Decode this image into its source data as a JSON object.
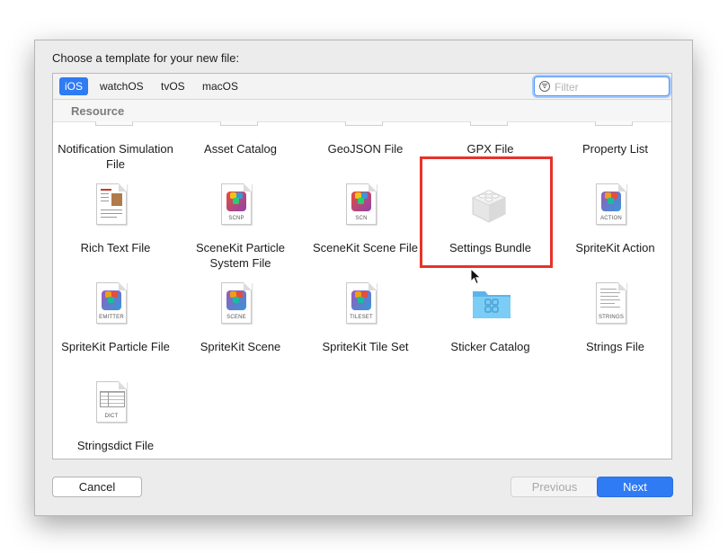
{
  "dialog": {
    "prompt": "Choose a template for your new file:"
  },
  "platform_tabs": [
    {
      "label": "iOS",
      "selected": true
    },
    {
      "label": "watchOS",
      "selected": false
    },
    {
      "label": "tvOS",
      "selected": false
    },
    {
      "label": "macOS",
      "selected": false
    }
  ],
  "filter": {
    "placeholder": "Filter",
    "value": "",
    "icon": "filter-icon"
  },
  "section": {
    "title": "Resource"
  },
  "templates": [
    {
      "label": "Notification Simulation File",
      "icon": "document-icon",
      "selected": false
    },
    {
      "label": "Asset Catalog",
      "icon": "asset-catalog-icon",
      "selected": false
    },
    {
      "label": "GeoJSON File",
      "icon": "geojson-icon",
      "selected": false
    },
    {
      "label": "GPX File",
      "icon": "gpx-icon",
      "selected": false
    },
    {
      "label": "Property List",
      "icon": "property-list-icon",
      "selected": false
    },
    {
      "label": "Rich Text File",
      "icon": "rich-text-icon",
      "selected": false
    },
    {
      "label": "SceneKit Particle System File",
      "icon": "scenekit-icon",
      "tag": "SCNP",
      "selected": false
    },
    {
      "label": "SceneKit Scene File",
      "icon": "scenekit-icon",
      "tag": "SCN",
      "selected": false
    },
    {
      "label": "Settings Bundle",
      "icon": "lego-brick-icon",
      "selected": true
    },
    {
      "label": "SpriteKit Action",
      "icon": "spritekit-icon",
      "tag": "ACTION",
      "selected": false
    },
    {
      "label": "SpriteKit Particle File",
      "icon": "spritekit-icon",
      "tag": "EMITTER",
      "selected": false
    },
    {
      "label": "SpriteKit Scene",
      "icon": "spritekit-icon",
      "tag": "SCENE",
      "selected": false
    },
    {
      "label": "SpriteKit Tile Set",
      "icon": "spritekit-icon",
      "tag": "TILESET",
      "selected": false
    },
    {
      "label": "Sticker Catalog",
      "icon": "folder-icon",
      "selected": false
    },
    {
      "label": "Strings File",
      "icon": "strings-file-icon",
      "tag": "STRINGS",
      "selected": false
    },
    {
      "label": "Stringsdict File",
      "icon": "stringsdict-icon",
      "tag": "DICT",
      "selected": false
    }
  ],
  "buttons": {
    "cancel": "Cancel",
    "previous": "Previous",
    "next": "Next"
  },
  "colors": {
    "accent": "#2f7bf4",
    "highlight_box": "#e8322a",
    "folder": "#6ec3f0"
  }
}
